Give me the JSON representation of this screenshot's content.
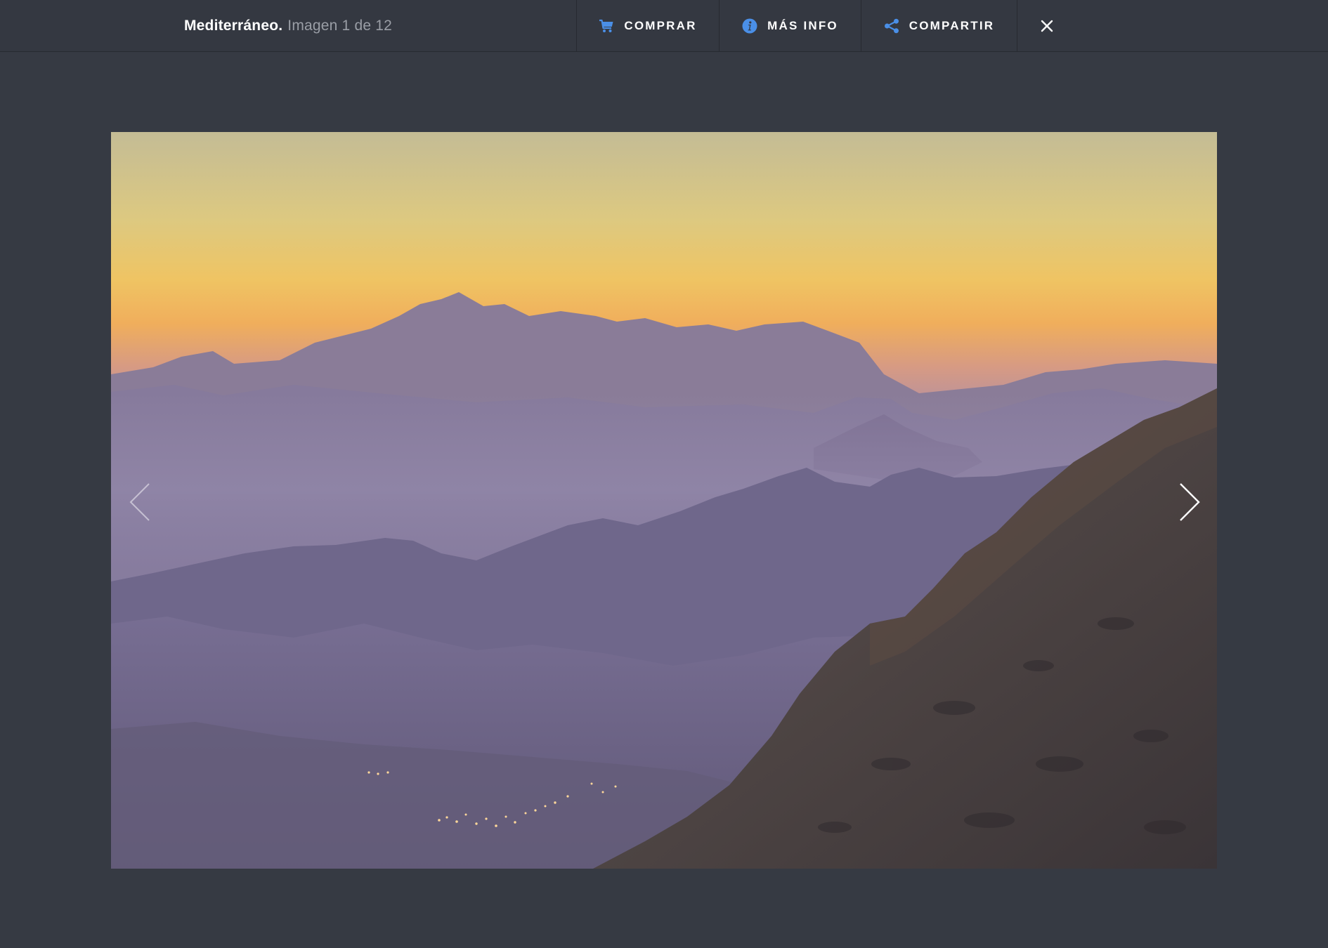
{
  "header": {
    "title": "Mediterráneo.",
    "counter": "Imagen 1 de 12"
  },
  "actions": {
    "buy_label": "COMPRAR",
    "info_label": "MÁS INFO",
    "share_label": "COMPARTIR"
  },
  "icons": {
    "buy": "cart-icon",
    "info": "info-icon",
    "share": "share-icon",
    "close": "close-icon",
    "prev": "chevron-left-icon",
    "next": "chevron-right-icon"
  },
  "colors": {
    "background": "#363a43",
    "topbar": "#343841",
    "icon_accent": "#4a8fe7",
    "sky_top": "#c7bf92",
    "sky_glow": "#f0b65e"
  }
}
